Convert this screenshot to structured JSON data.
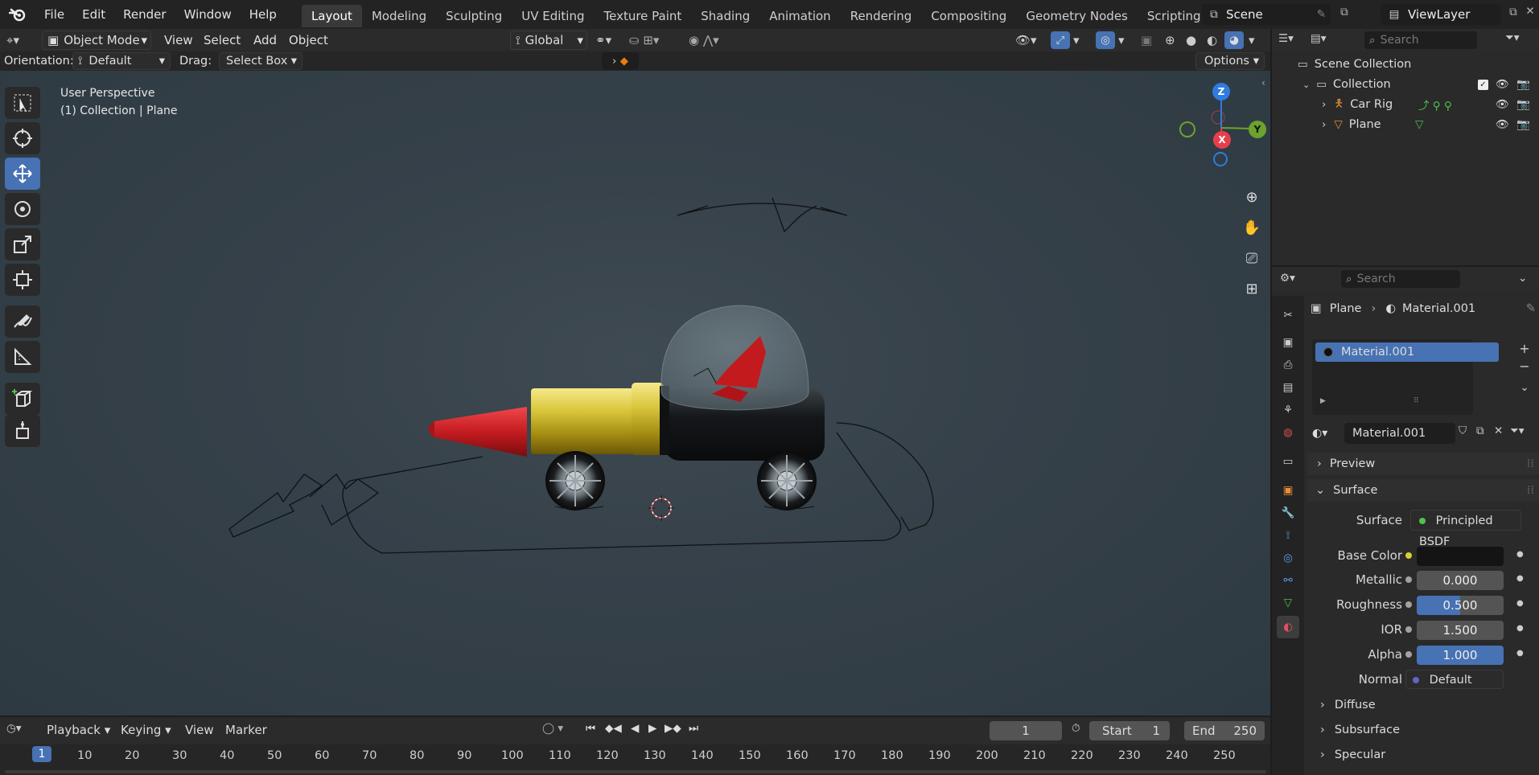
{
  "topbar": {
    "menus": [
      "File",
      "Edit",
      "Render",
      "Window",
      "Help"
    ],
    "workspaces": [
      "Layout",
      "Modeling",
      "Sculpting",
      "UV Editing",
      "Texture Paint",
      "Shading",
      "Animation",
      "Rendering",
      "Compositing",
      "Geometry Nodes",
      "Scripting"
    ],
    "active_workspace": "Layout",
    "scene": "Scene",
    "view_layer": "ViewLayer"
  },
  "viewport_header": {
    "mode": "Object Mode",
    "menus": [
      "View",
      "Select",
      "Add",
      "Object"
    ],
    "transform_orientation": "Global",
    "orientation_label": "Orientation:",
    "orientation_value": "Default",
    "drag_label": "Drag:",
    "drag_value": "Select Box",
    "options": "Options"
  },
  "viewport": {
    "view_name": "User Perspective",
    "context": "(1) Collection | Plane",
    "gizmo": {
      "z": "Z",
      "y": "Y",
      "x": "X"
    }
  },
  "outliner": {
    "search_placeholder": "Search",
    "root": "Scene Collection",
    "collection": "Collection",
    "items": [
      "Car Rig",
      "Plane"
    ]
  },
  "properties": {
    "search_placeholder": "Search",
    "breadcrumb_object": "Plane",
    "breadcrumb_material": "Material.001",
    "slot": "Material.001",
    "material_name": "Material.001",
    "panels": {
      "preview": "Preview",
      "surface": "Surface"
    },
    "surface_label": "Surface",
    "surface_shader": "Principled BSDF",
    "fields": [
      {
        "label": "Base Color",
        "value": ""
      },
      {
        "label": "Metallic",
        "value": "0.000"
      },
      {
        "label": "Roughness",
        "value": "0.500"
      },
      {
        "label": "IOR",
        "value": "1.500"
      },
      {
        "label": "Alpha",
        "value": "1.000"
      }
    ],
    "normal_label": "Normal",
    "normal_value": "Default",
    "subpanels": [
      "Diffuse",
      "Subsurface",
      "Specular"
    ],
    "base_color_hex": "#141414",
    "accent": "#4772b3"
  },
  "timeline": {
    "menus": [
      "Playback",
      "Keying",
      "View",
      "Marker"
    ],
    "current_frame": "1",
    "start_label": "Start",
    "start": "1",
    "end_label": "End",
    "end": "250",
    "ruler": [
      "1",
      "10",
      "20",
      "30",
      "40",
      "50",
      "60",
      "70",
      "80",
      "90",
      "100",
      "110",
      "120",
      "130",
      "140",
      "150",
      "160",
      "170",
      "180",
      "190",
      "200",
      "210",
      "220",
      "230",
      "240",
      "250"
    ]
  }
}
